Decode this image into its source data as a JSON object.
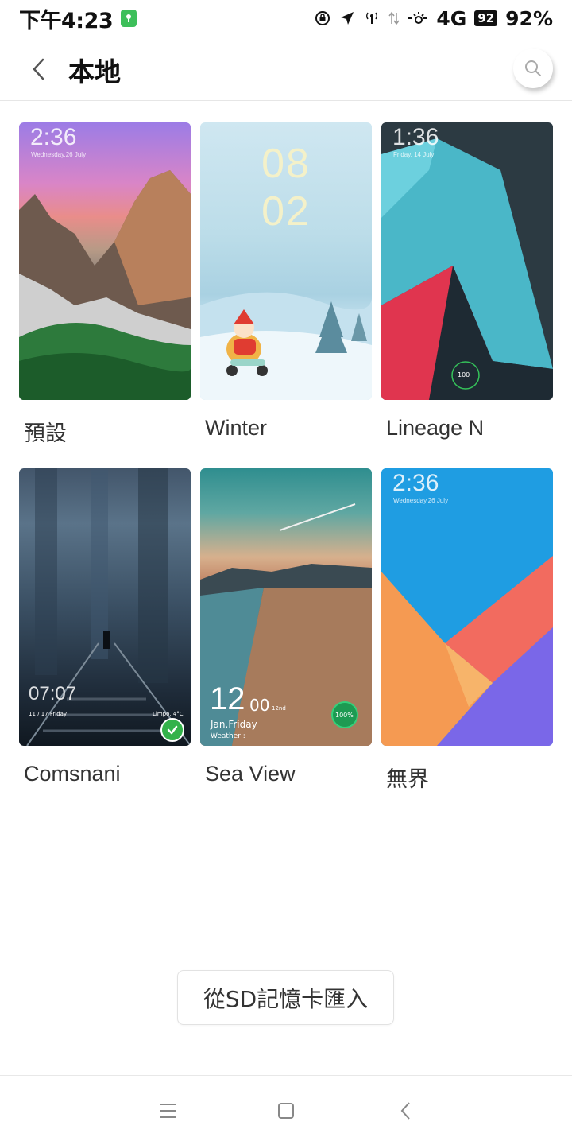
{
  "status_bar": {
    "time": "下午4:23",
    "network": "4G",
    "battery_box": "92",
    "battery_percent": "92%",
    "icons": [
      "app-badge-icon",
      "rotation-lock-icon",
      "location-arrow-icon",
      "hotspot-icon",
      "data-arrows-icon",
      "signal-icon",
      "battery-icon"
    ]
  },
  "header": {
    "title": "本地",
    "back_icon": "chevron-left-icon",
    "search_icon": "search-icon"
  },
  "themes": [
    {
      "name": "預設",
      "clock": "2:36",
      "date": "Wednesday,26 July",
      "selected": false
    },
    {
      "name": "Winter",
      "clock_top": "08",
      "clock_bottom": "02",
      "selected": false
    },
    {
      "name": "Lineage N",
      "clock": "1:36",
      "date": "Friday, 14 July",
      "ring_value": "100",
      "selected": false
    },
    {
      "name": "Comsnani",
      "clock": "07:07",
      "date": "11 / 17 Friday",
      "weather": "Limpo, 4°C",
      "selected": true
    },
    {
      "name": "Sea View",
      "clock": "12",
      "clock_small": "00",
      "day_suffix": "12nd",
      "date": "Jan.Friday",
      "weather": "Weather :",
      "battery_ring": "100%",
      "selected": false
    },
    {
      "name": "無界",
      "clock": "2:36",
      "date": "Wednesday,26 July",
      "selected": false
    }
  ],
  "import_button": {
    "label": "從SD記憶卡匯入"
  },
  "nav_bar": {
    "icons": [
      "menu-icon",
      "home-icon",
      "back-icon"
    ]
  },
  "colors": {
    "accent_green": "#33b24a",
    "divider": "#e6e6e6"
  }
}
